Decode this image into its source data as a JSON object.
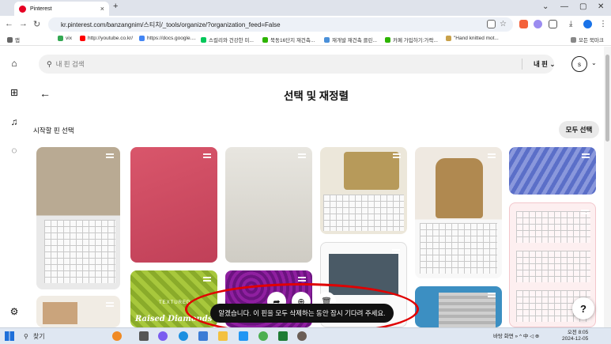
{
  "browser": {
    "tab_title": "Pinterest",
    "tab_close": "×",
    "new_tab": "+",
    "url": "kr.pinterest.com/banzangnim/스티치/_tools/organize/?organization_feed=False",
    "window_controls": [
      "⌄",
      "—",
      "▢",
      "✕"
    ]
  },
  "bookmarks": [
    "앱",
    "vix",
    "http://youtube.co.kr/",
    "https://docs.google....",
    "스컬리와 건강한 미...",
    "북동16단지 재건축...",
    "재개발 재건축 클린...",
    "카페 가입하기:가락...",
    "\"Hand knitted mot...",
    "모든 북마크"
  ],
  "pinterest": {
    "search_placeholder": "내 핀 검색",
    "board_selector": "내 핀",
    "avatar_letter": "s",
    "back_arrow": "←",
    "page_title": "선택 및 재정렬",
    "pick_label": "시작할 핀 선택",
    "select_all": "모두 선택",
    "toast": "알겠습니다. 이 핀을 모두 삭제하는 동안 잠시 기다려 주세요.",
    "help": "?",
    "pin_text_diamond": "Raised Diamonds Stitch",
    "pin_text_textured": "TEXTURED"
  },
  "taskbar": {
    "search_label": "찾기",
    "tray_text": "바탕 화면",
    "time": "오전 8:05",
    "date": "2024-12-05"
  },
  "colors": {
    "accent": "#e60023",
    "toast_bg": "#111111",
    "highlight_oval": "#e00000"
  }
}
